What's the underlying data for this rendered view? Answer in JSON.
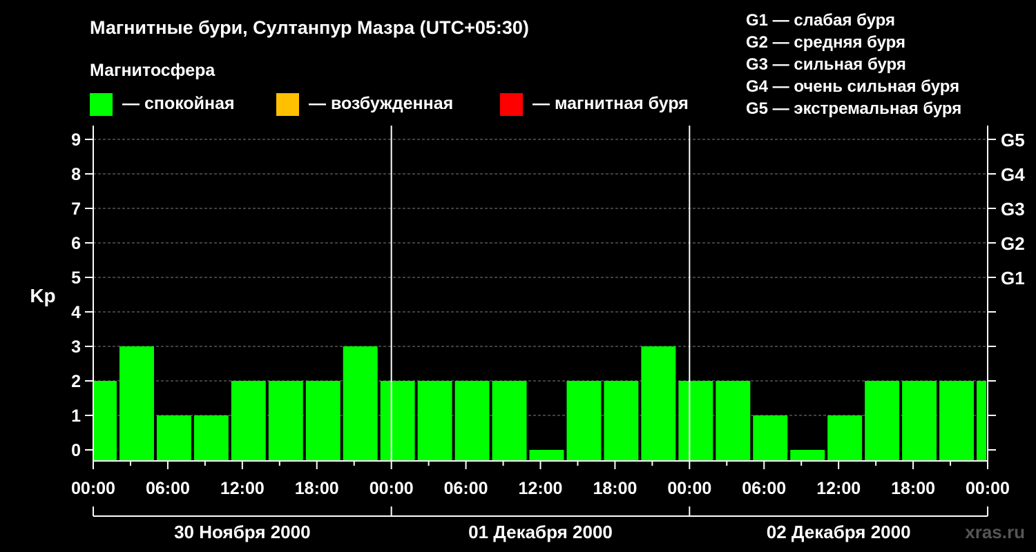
{
  "title": "Магнитные бури, Султанпур Мазра (UTC+05:30)",
  "magnetosphere_label": "Магнитосфера",
  "legend": [
    {
      "label": "— спокойная",
      "color": "#00ff00"
    },
    {
      "label": "— возбужденная",
      "color": "#ffc000"
    },
    {
      "label": "— магнитная буря",
      "color": "#ff0000"
    }
  ],
  "g_scale": [
    "G1 — слабая буря",
    "G2 — средняя буря",
    "G3 — сильная буря",
    "G4 — очень сильная буря",
    "G5 — экстремальная буря"
  ],
  "watermark": "xras.ru",
  "chart_data": {
    "type": "bar",
    "ylabel": "Kp",
    "ylim": [
      0,
      9
    ],
    "yticks": [
      "0",
      "1",
      "2",
      "3",
      "4",
      "5",
      "6",
      "7",
      "8",
      "9"
    ],
    "right_ticks": [
      {
        "value": 5,
        "label": "G1"
      },
      {
        "value": 6,
        "label": "G2"
      },
      {
        "value": 7,
        "label": "G3"
      },
      {
        "value": 8,
        "label": "G4"
      },
      {
        "value": 9,
        "label": "G5"
      }
    ],
    "x_hours_range": [
      0,
      72
    ],
    "x_tick_labels": [
      "00:00",
      "06:00",
      "12:00",
      "18:00",
      "00:00",
      "06:00",
      "12:00",
      "18:00",
      "00:00",
      "06:00",
      "12:00",
      "18:00",
      "00:00"
    ],
    "days": [
      "30 Ноября 2000",
      "01 Декабря 2000",
      "02 Декабря 2000"
    ],
    "grid": true,
    "bar_color": "#00ff00",
    "bars": [
      {
        "start": 0,
        "end": 2,
        "kp": 2
      },
      {
        "start": 2,
        "end": 5,
        "kp": 3
      },
      {
        "start": 5,
        "end": 8,
        "kp": 1
      },
      {
        "start": 8,
        "end": 11,
        "kp": 1
      },
      {
        "start": 11,
        "end": 14,
        "kp": 2
      },
      {
        "start": 14,
        "end": 17,
        "kp": 2
      },
      {
        "start": 17,
        "end": 20,
        "kp": 2
      },
      {
        "start": 20,
        "end": 23,
        "kp": 3
      },
      {
        "start": 23,
        "end": 26,
        "kp": 2
      },
      {
        "start": 26,
        "end": 29,
        "kp": 2
      },
      {
        "start": 29,
        "end": 32,
        "kp": 2
      },
      {
        "start": 32,
        "end": 35,
        "kp": 2
      },
      {
        "start": 35,
        "end": 38,
        "kp": 0
      },
      {
        "start": 38,
        "end": 41,
        "kp": 2
      },
      {
        "start": 41,
        "end": 44,
        "kp": 2
      },
      {
        "start": 44,
        "end": 47,
        "kp": 3
      },
      {
        "start": 47,
        "end": 50,
        "kp": 2
      },
      {
        "start": 50,
        "end": 53,
        "kp": 2
      },
      {
        "start": 53,
        "end": 56,
        "kp": 1
      },
      {
        "start": 56,
        "end": 59,
        "kp": 0
      },
      {
        "start": 59,
        "end": 62,
        "kp": 1
      },
      {
        "start": 62,
        "end": 65,
        "kp": 2
      },
      {
        "start": 65,
        "end": 68,
        "kp": 2
      },
      {
        "start": 68,
        "end": 71,
        "kp": 2
      },
      {
        "start": 71,
        "end": 72,
        "kp": 2
      }
    ]
  }
}
